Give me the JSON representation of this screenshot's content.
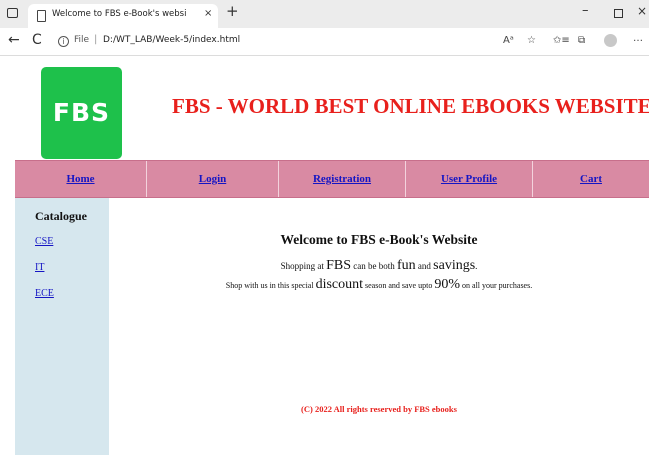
{
  "browser": {
    "tab_title": "Welcome to FBS e-Book's websi",
    "tab_close": "×",
    "new_tab": "+",
    "file_label": "File",
    "url": "D:/WT_LAB/Week-5/index.html",
    "icons": [
      "window-icon",
      "page-icon",
      "back-arrow-icon",
      "reload-icon",
      "info-icon",
      "read-aloud-icon",
      "add-favorite-icon",
      "favorites-icon",
      "collections-icon",
      "profile-icon",
      "more-icon"
    ],
    "window_controls": {
      "minimize": "–",
      "close": "×"
    },
    "back_glyph": "←",
    "reload_glyph": "C",
    "info_glyph": "i",
    "read_glyph": "Aᵃ",
    "fav_glyph": "☆",
    "favs_glyph": "✩≡",
    "coll_glyph": "⧉",
    "more_glyph": "…"
  },
  "header": {
    "logo_text": "FBS",
    "logo_color": "#1ec14b",
    "title": "FBS - WORLD BEST ONLINE EBOOKS WEBSITE",
    "title_color": "#e8201c"
  },
  "nav": {
    "bg_color": "#d98aa3",
    "items": [
      {
        "label": "Home"
      },
      {
        "label": "Login"
      },
      {
        "label": "Registration"
      },
      {
        "label": "User Profile"
      },
      {
        "label": "Cart"
      }
    ]
  },
  "sidebar": {
    "bg_color": "#d6e7ee",
    "title": "Catalogue",
    "links": [
      {
        "label": "CSE"
      },
      {
        "label": "IT"
      },
      {
        "label": "ECE"
      }
    ]
  },
  "main": {
    "welcome": "Welcome to FBS e-Book's Website",
    "line1": {
      "a": "Shopping at ",
      "b": "FBS",
      "c": " can be both ",
      "d": "fun",
      "e": " and ",
      "f": "savings",
      "g": "."
    },
    "line2": {
      "a": "Shop with us in this special ",
      "b": "discount",
      "c": " season and save upto ",
      "d": "90%",
      "e": " on all your purchases."
    },
    "copyright": "(C) 2022 All rights reserved by FBS ebooks"
  }
}
